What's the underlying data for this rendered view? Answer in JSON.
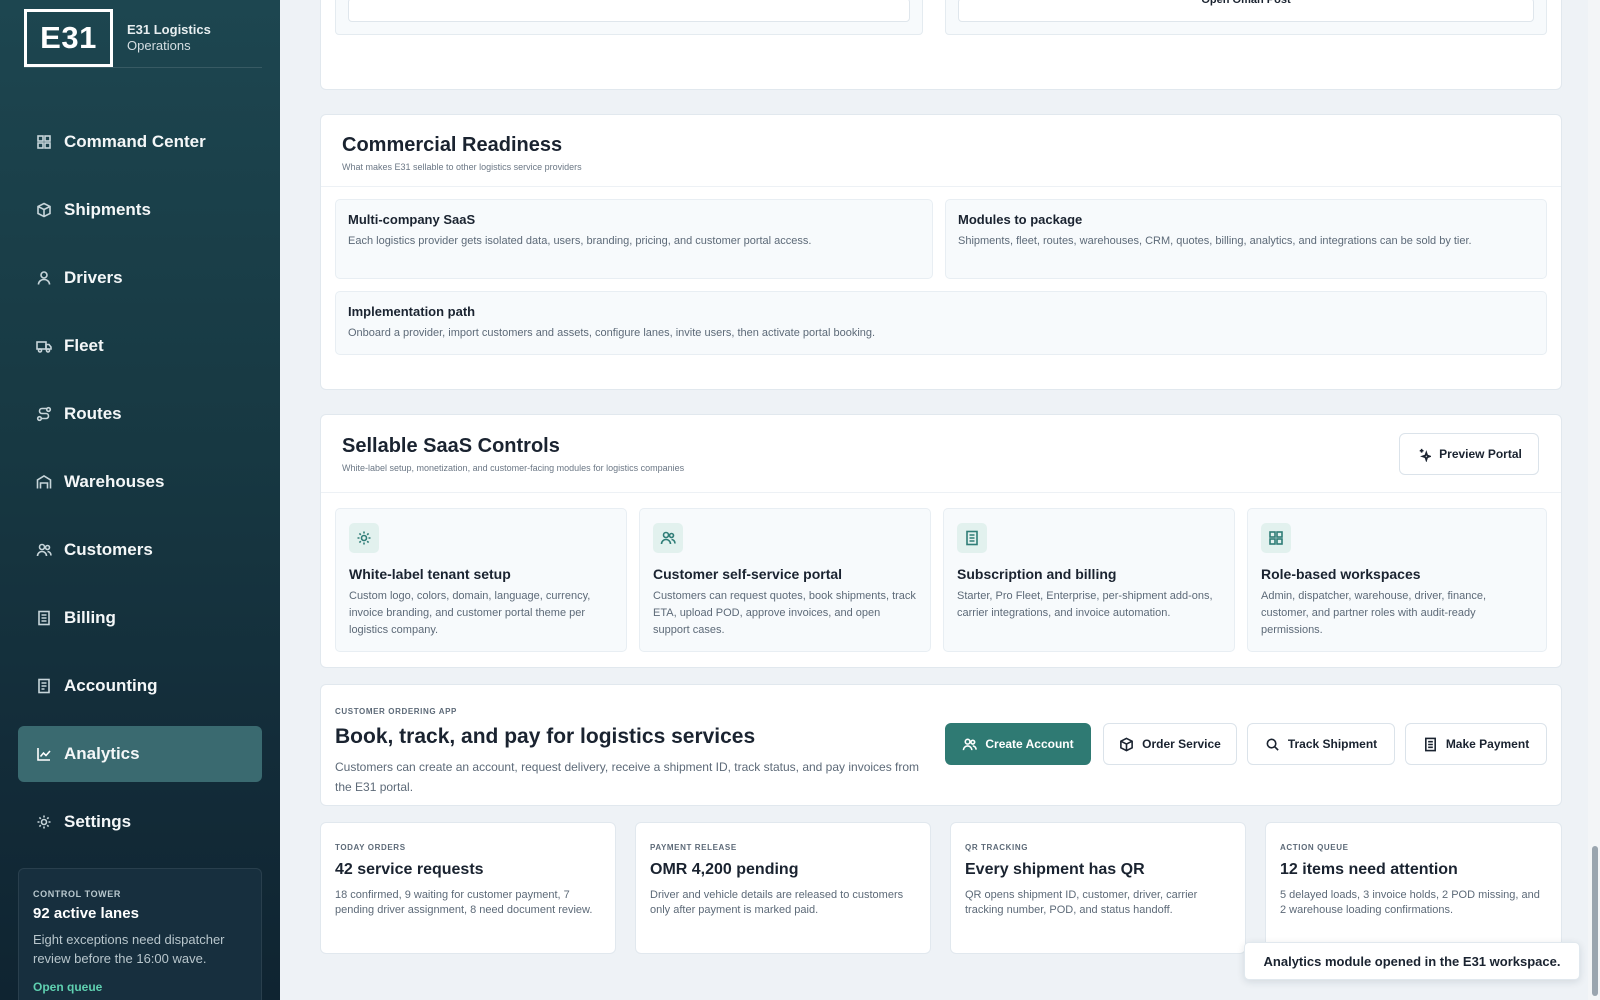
{
  "brand": {
    "logo": "E31",
    "name": "E31 Logistics",
    "subtitle": "Operations"
  },
  "sidebar": {
    "items": [
      {
        "label": "Command Center",
        "icon": "grid-icon"
      },
      {
        "label": "Shipments",
        "icon": "box-icon"
      },
      {
        "label": "Drivers",
        "icon": "user-icon"
      },
      {
        "label": "Fleet",
        "icon": "truck-icon"
      },
      {
        "label": "Routes",
        "icon": "route-icon"
      },
      {
        "label": "Warehouses",
        "icon": "warehouse-icon"
      },
      {
        "label": "Customers",
        "icon": "users-icon"
      },
      {
        "label": "Billing",
        "icon": "receipt-icon"
      },
      {
        "label": "Accounting",
        "icon": "ledger-icon"
      },
      {
        "label": "Analytics",
        "icon": "chart-icon",
        "active": true
      },
      {
        "label": "Settings",
        "icon": "gear-icon"
      }
    ],
    "control_tower": {
      "eyebrow": "CONTROL TOWER",
      "title": "92 active lanes",
      "description": "Eight exceptions need dispatcher review before the 16:00 wave.",
      "link": "Open queue"
    }
  },
  "top_card": {
    "right_button": "Open Oman Post"
  },
  "commercial": {
    "title": "Commercial Readiness",
    "subtitle": "What makes E31 sellable to other logistics service providers",
    "tiles": [
      {
        "title": "Multi-company SaaS",
        "desc": "Each logistics provider gets isolated data, users, branding, pricing, and customer portal access."
      },
      {
        "title": "Modules to package",
        "desc": "Shipments, fleet, routes, warehouses, CRM, quotes, billing, analytics, and integrations can be sold by tier."
      },
      {
        "title": "Implementation path",
        "desc": "Onboard a provider, import customers and assets, configure lanes, invite users, then activate portal booking."
      }
    ]
  },
  "saas": {
    "title": "Sellable SaaS Controls",
    "subtitle": "White-label setup, monetization, and customer-facing modules for logistics companies",
    "preview_button": "Preview Portal",
    "tiles": [
      {
        "icon": "gear-icon",
        "title": "White-label tenant setup",
        "desc": "Custom logo, colors, domain, language, currency, invoice branding, and customer portal theme per logistics company."
      },
      {
        "icon": "users-icon",
        "title": "Customer self-service portal",
        "desc": "Customers can request quotes, book shipments, track ETA, upload POD, approve invoices, and open support cases."
      },
      {
        "icon": "receipt-icon",
        "title": "Subscription and billing",
        "desc": "Starter, Pro Fleet, Enterprise, per-shipment add-ons, carrier integrations, and invoice automation."
      },
      {
        "icon": "grid-icon",
        "title": "Role-based workspaces",
        "desc": "Admin, dispatcher, warehouse, driver, finance, customer, and partner roles with audit-ready permissions."
      }
    ]
  },
  "ordering": {
    "eyebrow": "CUSTOMER ORDERING APP",
    "title": "Book, track, and pay for logistics services",
    "desc": "Customers can create an account, request delivery, receive a shipment ID, track status, and pay invoices from the E31 portal.",
    "buttons": {
      "create": "Create Account",
      "order": "Order Service",
      "track": "Track Shipment",
      "pay": "Make Payment"
    }
  },
  "stats": [
    {
      "eyebrow": "TODAY ORDERS",
      "title": "42 service requests",
      "desc": "18 confirmed, 9 waiting for customer payment, 7 pending driver assignment, 8 need document review."
    },
    {
      "eyebrow": "PAYMENT RELEASE",
      "title": "OMR 4,200 pending",
      "desc": "Driver and vehicle details are released to customers only after payment is marked paid."
    },
    {
      "eyebrow": "QR TRACKING",
      "title": "Every shipment has QR",
      "desc": "QR opens shipment ID, customer, driver, carrier tracking number, POD, and status handoff."
    },
    {
      "eyebrow": "ACTION QUEUE",
      "title": "12 items need attention",
      "desc": "5 delayed loads, 3 invoice holds, 2 POD missing, and 2 warehouse loading confirmations."
    }
  ],
  "toast": "Analytics module opened in the E31 workspace.",
  "colors": {
    "accent": "#2f7a73",
    "sidebar_bg": "#173842",
    "page_bg": "#eef2f6"
  }
}
